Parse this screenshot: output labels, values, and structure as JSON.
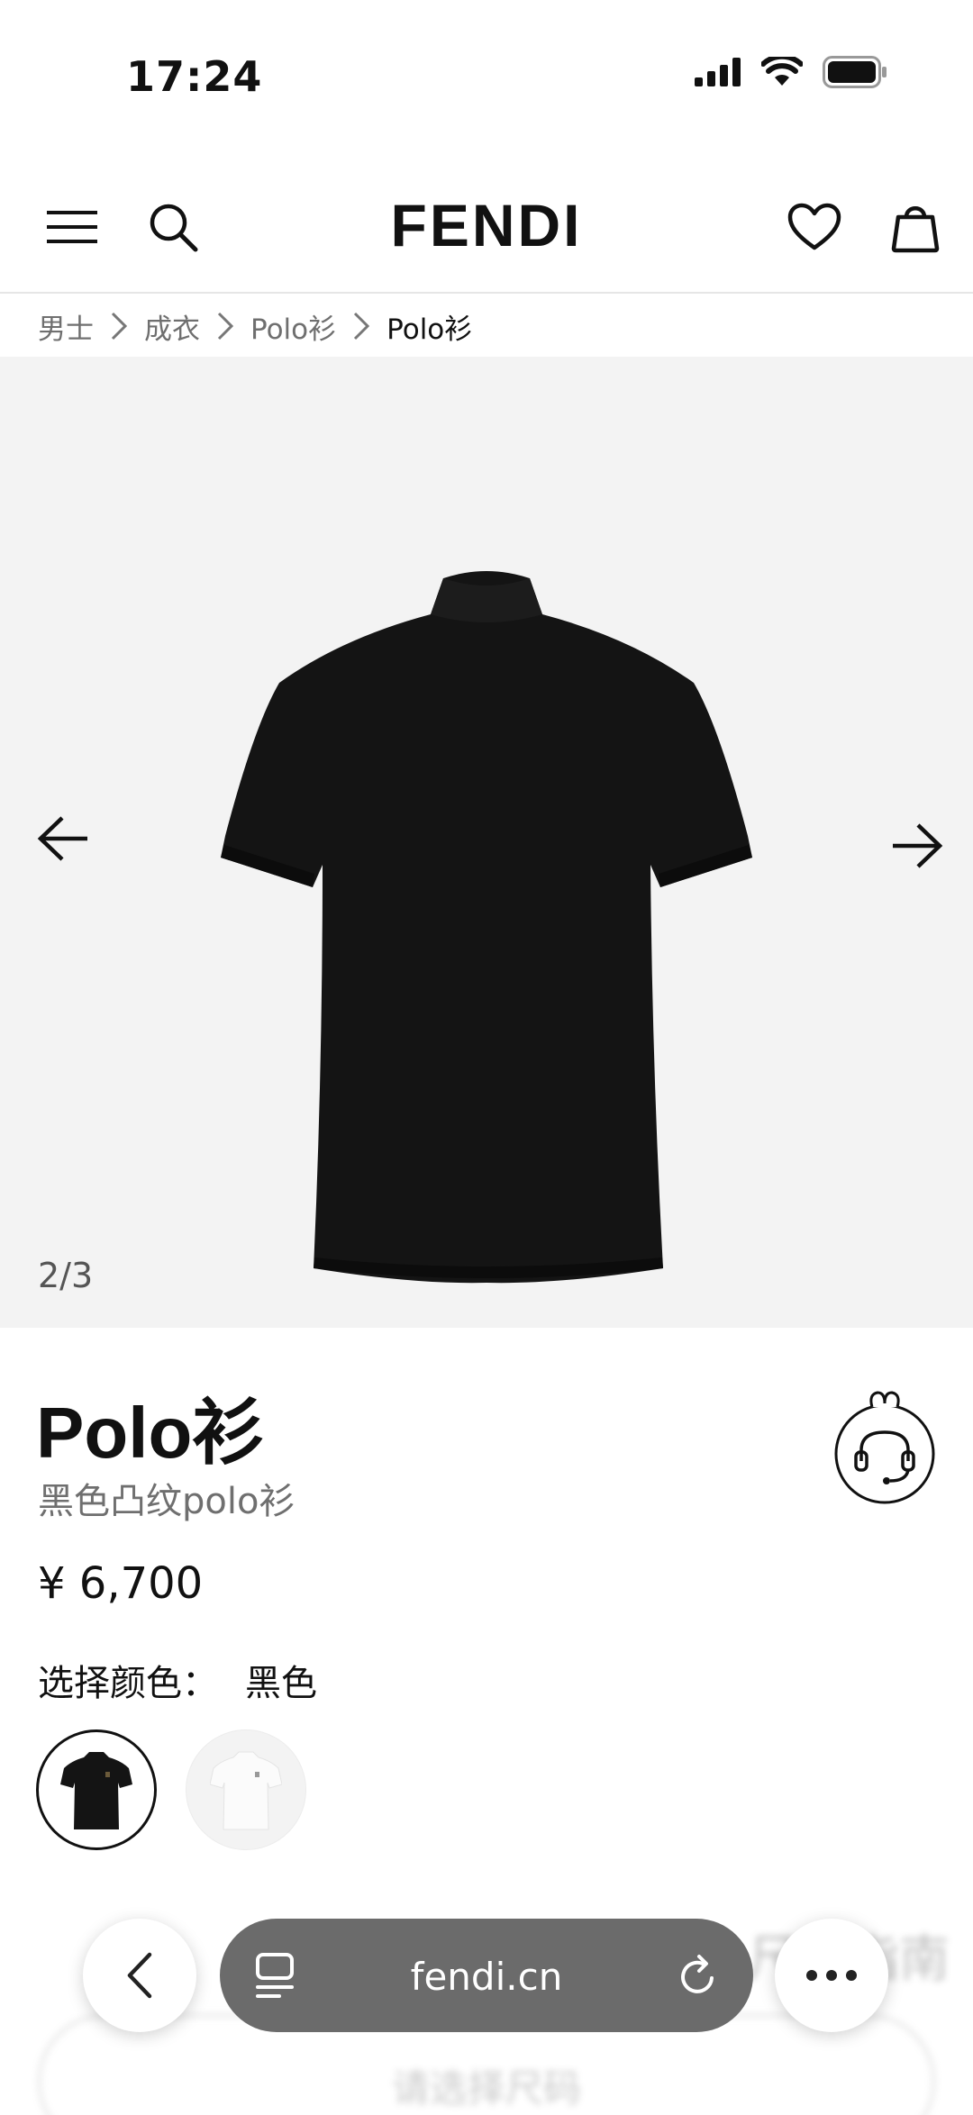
{
  "status_bar": {
    "time": "17:24"
  },
  "header": {
    "brand": "FENDI",
    "icons": [
      "menu-icon",
      "search-icon",
      "heart-icon",
      "shopping-bag-icon"
    ]
  },
  "breadcrumb": {
    "items": [
      "男士",
      "成衣",
      "Polo衫",
      "Polo衫"
    ]
  },
  "gallery": {
    "counter": "2/3"
  },
  "product": {
    "title": "Polo衫",
    "subtitle": "黑色凸纹polo衫",
    "price": "¥ 6,700",
    "color_label": "选择颜色：",
    "color_value": "黑色"
  },
  "background_content": {
    "size_guide": "尺寸指南",
    "size_select_placeholder": "请选择尺码"
  },
  "browser": {
    "url": "fendi.cn"
  },
  "colors": {
    "text": "#111111",
    "muted": "#6f6f6f",
    "gallery_bg": "#f3f3f3",
    "url_bar": "#6b6b6b"
  }
}
